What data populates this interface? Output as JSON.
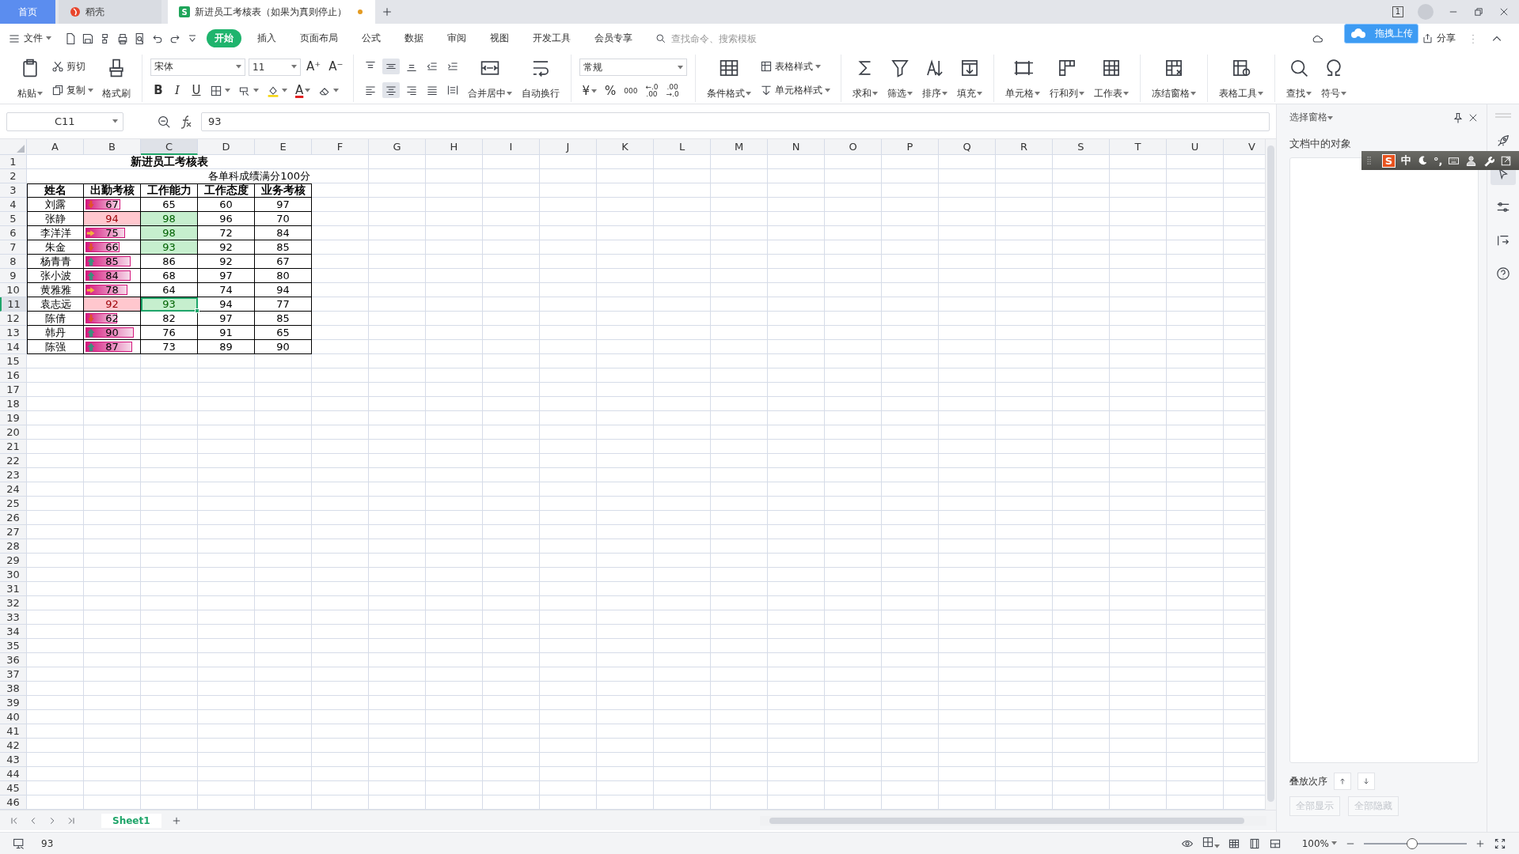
{
  "tabs": [
    {
      "label": "首页",
      "kind": "home",
      "selected": false,
      "modified": false
    },
    {
      "label": "稻壳",
      "kind": "docer",
      "selected": false,
      "modified": false
    },
    {
      "label": "新进员工考核表（如果为真则停止）",
      "kind": "sheet",
      "logo": "S",
      "selected": true,
      "modified": true
    }
  ],
  "window": {
    "count": "1"
  },
  "menu": {
    "file": "文件",
    "tabs": [
      {
        "label": "开始",
        "selected": true
      },
      {
        "label": "插入",
        "selected": false
      },
      {
        "label": "页面布局",
        "selected": false
      },
      {
        "label": "公式",
        "selected": false
      },
      {
        "label": "数据",
        "selected": false
      },
      {
        "label": "审阅",
        "selected": false
      },
      {
        "label": "视图",
        "selected": false
      },
      {
        "label": "开发工具",
        "selected": false
      },
      {
        "label": "会员专享",
        "selected": false
      }
    ],
    "search": {
      "placeholder": "查找命令、搜索模板"
    },
    "share": "分享",
    "upload_tip": "拖拽上传"
  },
  "ribbon": [
    {
      "items": [
        {
          "kind": "large",
          "label": "粘贴",
          "caret": true
        },
        {
          "kind": "stack",
          "rows": [
            [
              {
                "kind": "small",
                "label": "剪切"
              }
            ],
            [
              {
                "kind": "small",
                "label": "复制",
                "caret": true
              }
            ]
          ]
        },
        {
          "kind": "large",
          "label": "格式刷"
        }
      ]
    },
    {
      "items": [
        {
          "kind": "stack",
          "rows": [
            [
              {
                "kind": "select",
                "value": "宋体"
              },
              {
                "kind": "select",
                "value": "11"
              },
              {
                "kind": "glyph",
                "label": "A⁺"
              },
              {
                "kind": "glyph",
                "label": "A⁻"
              }
            ],
            [
              {
                "kind": "glyph",
                "label": "B"
              },
              {
                "kind": "glyph",
                "label": "I"
              },
              {
                "kind": "glyph",
                "label": "U"
              },
              {
                "kind": "small",
                "caret": true
              },
              {
                "kind": "small",
                "caret": true
              },
              {
                "kind": "small",
                "caret": true
              },
              {
                "kind": "glyph",
                "label": "A",
                "caret": true
              },
              {
                "kind": "small",
                "caret": true
              }
            ]
          ]
        }
      ]
    },
    {
      "items": [
        {
          "kind": "stack",
          "rows": [
            [
              {
                "kind": "small",
                "selected": false
              },
              {
                "kind": "small",
                "selected": true
              },
              {
                "kind": "small",
                "selected": false
              },
              {
                "kind": "small",
                "selected": false
              },
              {
                "kind": "small",
                "selected": false
              }
            ],
            [
              {
                "kind": "small",
                "selected": false
              },
              {
                "kind": "small",
                "selected": true
              },
              {
                "kind": "small",
                "selected": false
              },
              {
                "kind": "small",
                "selected": false
              },
              {
                "kind": "small",
                "selected": false
              }
            ]
          ]
        },
        {
          "kind": "large",
          "label": "合并居中",
          "caret": true
        },
        {
          "kind": "large",
          "label": "自动换行"
        }
      ]
    },
    {
      "items": [
        {
          "kind": "stack",
          "rows": [
            [
              {
                "kind": "select",
                "value": "常规"
              }
            ],
            [
              {
                "kind": "glyph",
                "label": "¥",
                "caret": true
              },
              {
                "kind": "glyph",
                "label": "%"
              },
              {
                "kind": "glyph",
                "label": "000"
              },
              {
                "kind": "glyph",
                "label": "←.0\n.00"
              },
              {
                "kind": "glyph",
                "label": ".00\n→.0"
              }
            ]
          ]
        }
      ]
    },
    {
      "items": [
        {
          "kind": "large",
          "label": "条件格式",
          "caret": true
        },
        {
          "kind": "stack",
          "rows": [
            [
              {
                "kind": "small",
                "label": "表格样式",
                "caret": true
              }
            ],
            [
              {
                "kind": "small",
                "label": "单元格样式",
                "caret": true
              }
            ]
          ]
        }
      ]
    },
    {
      "items": [
        {
          "kind": "large",
          "label": "求和",
          "caret": true
        },
        {
          "kind": "large",
          "label": "筛选",
          "caret": true
        },
        {
          "kind": "large",
          "label": "排序",
          "caret": true
        },
        {
          "kind": "large",
          "label": "填充",
          "caret": true
        }
      ]
    },
    {
      "items": [
        {
          "kind": "large",
          "label": "单元格",
          "caret": true
        },
        {
          "kind": "large",
          "label": "行和列",
          "caret": true
        },
        {
          "kind": "large",
          "label": "工作表",
          "caret": true
        }
      ]
    },
    {
      "items": [
        {
          "kind": "large",
          "label": "冻结窗格",
          "caret": true
        }
      ]
    },
    {
      "items": [
        {
          "kind": "large",
          "label": "表格工具",
          "caret": true
        }
      ]
    },
    {
      "items": [
        {
          "kind": "large",
          "label": "查找",
          "caret": true
        },
        {
          "kind": "large",
          "label": "符号",
          "caret": true
        }
      ]
    }
  ],
  "formula_bar": {
    "cell": "C11",
    "value": "93"
  },
  "sheet": {
    "columns": [
      {
        "label": "A",
        "selected": false
      },
      {
        "label": "B",
        "selected": false
      },
      {
        "label": "C",
        "selected": true
      },
      {
        "label": "D",
        "selected": false
      },
      {
        "label": "E",
        "selected": false
      },
      {
        "label": "F",
        "selected": false
      },
      {
        "label": "G",
        "selected": false
      },
      {
        "label": "H",
        "selected": false
      },
      {
        "label": "I",
        "selected": false
      },
      {
        "label": "J",
        "selected": false
      },
      {
        "label": "K",
        "selected": false
      },
      {
        "label": "L",
        "selected": false
      },
      {
        "label": "M",
        "selected": false
      },
      {
        "label": "N",
        "selected": false
      },
      {
        "label": "O",
        "selected": false
      },
      {
        "label": "P",
        "selected": false
      },
      {
        "label": "Q",
        "selected": false
      },
      {
        "label": "R",
        "selected": false
      },
      {
        "label": "S",
        "selected": false
      },
      {
        "label": "T",
        "selected": false
      },
      {
        "label": "U",
        "selected": false
      },
      {
        "label": "V",
        "selected": false
      }
    ],
    "row_numbers": [
      {
        "label": "1",
        "selected": false
      },
      {
        "label": "2",
        "selected": false
      },
      {
        "label": "3",
        "selected": false
      },
      {
        "label": "4",
        "selected": false
      },
      {
        "label": "5",
        "selected": false
      },
      {
        "label": "6",
        "selected": false
      },
      {
        "label": "7",
        "selected": false
      },
      {
        "label": "8",
        "selected": false
      },
      {
        "label": "9",
        "selected": false
      },
      {
        "label": "10",
        "selected": false
      },
      {
        "label": "11",
        "selected": true
      },
      {
        "label": "12",
        "selected": false
      },
      {
        "label": "13",
        "selected": false
      },
      {
        "label": "14",
        "selected": false
      },
      {
        "label": "15",
        "selected": false
      },
      {
        "label": "16",
        "selected": false
      },
      {
        "label": "17",
        "selected": false
      },
      {
        "label": "18",
        "selected": false
      },
      {
        "label": "19",
        "selected": false
      },
      {
        "label": "20",
        "selected": false
      },
      {
        "label": "21",
        "selected": false
      },
      {
        "label": "22",
        "selected": false
      },
      {
        "label": "23",
        "selected": false
      },
      {
        "label": "24",
        "selected": false
      },
      {
        "label": "25",
        "selected": false
      },
      {
        "label": "26",
        "selected": false
      },
      {
        "label": "27",
        "selected": false
      },
      {
        "label": "28",
        "selected": false
      },
      {
        "label": "29",
        "selected": false
      },
      {
        "label": "30",
        "selected": false
      },
      {
        "label": "31",
        "selected": false
      },
      {
        "label": "32",
        "selected": false
      },
      {
        "label": "33",
        "selected": false
      },
      {
        "label": "34",
        "selected": false
      },
      {
        "label": "35",
        "selected": false
      },
      {
        "label": "36",
        "selected": false
      },
      {
        "label": "37",
        "selected": false
      },
      {
        "label": "38",
        "selected": false
      },
      {
        "label": "39",
        "selected": false
      },
      {
        "label": "40",
        "selected": false
      },
      {
        "label": "41",
        "selected": false
      },
      {
        "label": "42",
        "selected": false
      },
      {
        "label": "43",
        "selected": false
      },
      {
        "label": "44",
        "selected": false
      },
      {
        "label": "45",
        "selected": false
      },
      {
        "label": "46",
        "selected": false
      }
    ],
    "title": "新进员工考核表",
    "note": "各单科成绩满分100分",
    "headers": [
      "姓名",
      "出勤考核",
      "工作能力",
      "工作态度",
      "业务考核"
    ],
    "rows": [
      {
        "name": "刘露",
        "attendance": {
          "value": "67",
          "kind": "down",
          "level": 0.67
        },
        "ability": {
          "value": "65",
          "highlighted": false,
          "selected": false
        },
        "attitude": "60",
        "business": "97"
      },
      {
        "name": "张静",
        "attendance": {
          "value": "94",
          "kind": "highlight"
        },
        "ability": {
          "value": "98",
          "highlighted": true,
          "selected": false
        },
        "attitude": "96",
        "business": "70"
      },
      {
        "name": "李洋洋",
        "attendance": {
          "value": "75",
          "kind": "right",
          "level": 0.76
        },
        "ability": {
          "value": "98",
          "highlighted": true,
          "selected": false
        },
        "attitude": "72",
        "business": "84"
      },
      {
        "name": "朱金",
        "attendance": {
          "value": "66",
          "kind": "down",
          "level": 0.66
        },
        "ability": {
          "value": "93",
          "highlighted": true,
          "selected": false
        },
        "attitude": "92",
        "business": "85"
      },
      {
        "name": "杨青青",
        "attendance": {
          "value": "85",
          "kind": "up",
          "level": 0.86
        },
        "ability": {
          "value": "86",
          "highlighted": false,
          "selected": false
        },
        "attitude": "92",
        "business": "67"
      },
      {
        "name": "张小波",
        "attendance": {
          "value": "84",
          "kind": "up",
          "level": 0.86
        },
        "ability": {
          "value": "68",
          "highlighted": false,
          "selected": false
        },
        "attitude": "97",
        "business": "80"
      },
      {
        "name": "黄雅雅",
        "attendance": {
          "value": "78",
          "kind": "right",
          "level": 0.8
        },
        "ability": {
          "value": "64",
          "highlighted": false,
          "selected": false
        },
        "attitude": "74",
        "business": "94"
      },
      {
        "name": "袁志远",
        "attendance": {
          "value": "92",
          "kind": "highlight"
        },
        "ability": {
          "value": "93",
          "highlighted": true,
          "selected": true
        },
        "attitude": "94",
        "business": "77"
      },
      {
        "name": "陈倩",
        "attendance": {
          "value": "62",
          "kind": "down",
          "level": 0.62
        },
        "ability": {
          "value": "82",
          "highlighted": false,
          "selected": false
        },
        "attitude": "97",
        "business": "85"
      },
      {
        "name": "韩丹",
        "attendance": {
          "value": "90",
          "kind": "up",
          "level": 0.92
        },
        "ability": {
          "value": "76",
          "highlighted": false,
          "selected": false
        },
        "attitude": "91",
        "business": "65"
      },
      {
        "name": "陈强",
        "attendance": {
          "value": "87",
          "kind": "up",
          "level": 0.89
        },
        "ability": {
          "value": "73",
          "highlighted": false,
          "selected": false
        },
        "attitude": "89",
        "business": "90"
      }
    ]
  },
  "sheet_tabs": [
    {
      "label": "Sheet1",
      "selected": true
    }
  ],
  "selection_pane": {
    "title": "选择窗格",
    "heading": "文档中的对象",
    "order_label": "叠放次序",
    "buttons": [
      {
        "label": "全部显示",
        "disabled": true
      },
      {
        "label": "全部隐藏",
        "disabled": true
      }
    ]
  },
  "side_strip": [
    {
      "selected": false
    },
    {
      "selected": true
    },
    {
      "selected": false
    },
    {
      "selected": false
    },
    {
      "selected": false
    }
  ],
  "ime": {
    "logo": "S",
    "mode": "中",
    "punct": "°,"
  },
  "status": {
    "value": "93",
    "zoom": "100%",
    "zoom_slider": {
      "level": 0.47
    }
  }
}
